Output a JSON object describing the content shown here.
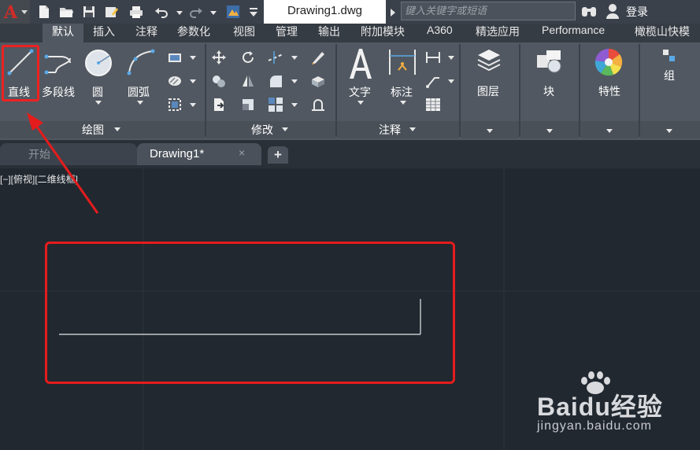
{
  "title_bar": {
    "document_title": "Drawing1.dwg",
    "search_placeholder": "键入关键字或短语",
    "login_label": "登录",
    "quick_access_icons": [
      "new-icon",
      "open-icon",
      "save-icon",
      "save-as-icon",
      "plot-icon",
      "undo-icon",
      "redo-icon",
      "workspace-icon",
      "customize-icon"
    ]
  },
  "ribbon_tabs": [
    "默认",
    "插入",
    "注释",
    "参数化",
    "视图",
    "管理",
    "输出",
    "附加模块",
    "A360",
    "精选应用",
    "Performance",
    "橄榄山快模"
  ],
  "active_tab": "默认",
  "panels": {
    "draw": {
      "title": "绘图",
      "large_tools": [
        "直线",
        "多段线",
        "圆",
        "圆弧"
      ]
    },
    "modify": {
      "title": "修改"
    },
    "annotation": {
      "title": "注释",
      "large_tools": [
        "文字",
        "标注"
      ]
    },
    "layers": {
      "label": "图层"
    },
    "block": {
      "label": "块"
    },
    "properties": {
      "label": "特性"
    },
    "groups": {
      "label": "组"
    }
  },
  "file_tabs": {
    "start": "开始",
    "drawing": "Drawing1*",
    "close_glyph": "×",
    "add_glyph": "+"
  },
  "viewport_label": "[−][俯视][二维线框]",
  "colors": {
    "highlight": "#e51c1c",
    "canvas_bg": "#212830",
    "ribbon_bg": "#515861"
  },
  "watermark": {
    "brand": "Baidu经验",
    "url": "jingyan.baidu.com"
  }
}
